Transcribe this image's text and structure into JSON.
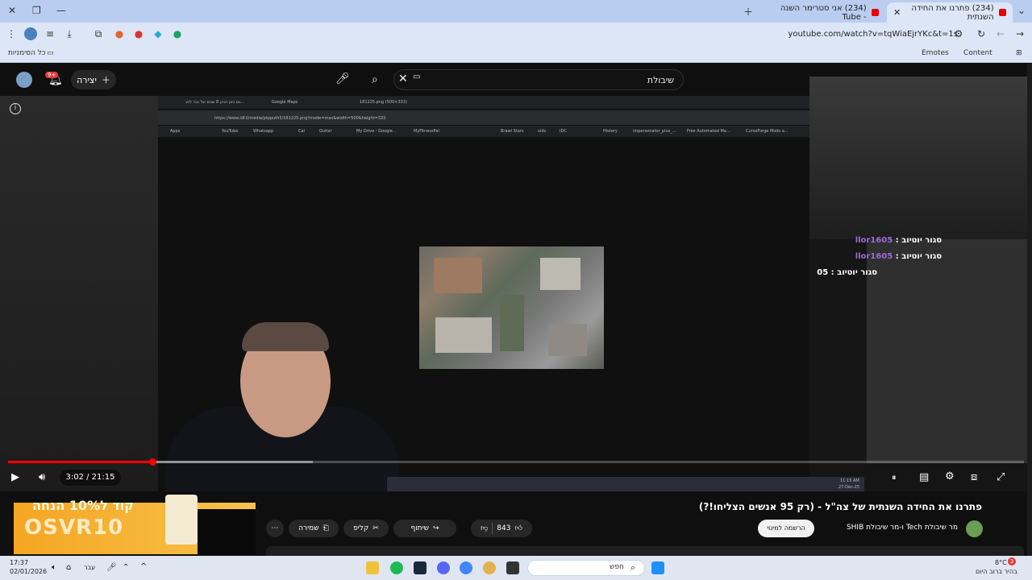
{
  "browser": {
    "tabs": [
      {
        "title": "(234) פתרנו את החידה השנתית",
        "active": true
      },
      {
        "title": "(234) אני סטרימר השנה - Tube",
        "active": false
      }
    ],
    "url": "youtube.com/watch?v=tqWiaEjrYKc&t=1s",
    "bookmarks_left": "כל הסימניות",
    "bookmarks_right": [
      "Emotes",
      "Content"
    ]
  },
  "youtube": {
    "search_query": "שיבולת",
    "create_label": "יצירה",
    "notif_badge": "9+",
    "video_title": "פתרנו את החידה השנתית של צה\"ל - (רק 95 אנשים הצליחו!?)",
    "channel_name": "מר שיבולת Tech ו-מר שיבולת SHIB",
    "subscribe_label": "הרשמה למינוי",
    "likes": "843",
    "share_label": "שיתוף",
    "clip_label": "קליפ",
    "save_label": "שמירה",
    "time_current": "3:02",
    "time_total": "21:15",
    "time_display": "3:02 / 21:15",
    "progress": {
      "played_fraction": 0.142,
      "buffered_fraction": 0.3
    }
  },
  "embedded_screen": {
    "tabs": [
      "גם כאן הגיע 8 שנים של נגה לפנ...",
      "Google Maps",
      "181225.png (500×333)"
    ],
    "url": "https://www.idf.il/media/ptpputh5/181225.png?mode=max&width=500&height=333",
    "bookmarks": [
      "Apps",
      "YouTube",
      "Whatsapp",
      "Cal",
      "Guitar",
      "My Drive - Google...",
      "MyFitnessPal",
      "Brawl Stars",
      "vids",
      "IDC",
      "History",
      "impersonator_plus_...",
      "Free Automated Ma...",
      "CurseForge Mods a..."
    ],
    "clock": "11:15 AM",
    "date": "27-Dec-25"
  },
  "chat": [
    {
      "badge_role": "סגור יוטיוב",
      "user": "llor1605",
      "text": ""
    },
    {
      "badge_role": "סגור יוטיוב",
      "user": "llor1605",
      "text": ""
    },
    {
      "badge_role": "סגור יוטיוב",
      "user": "",
      "text": "05"
    }
  ],
  "ad": {
    "text": "OSVR10",
    "top_text": "קוד ל10% הנחה"
  },
  "taskbar": {
    "search_label": "חפש",
    "time": "17:37",
    "date": "02/01/2026",
    "lang": "עבר",
    "weather_temp": "8°C",
    "weather_desc": "בהיר ברוב היום",
    "notif_count": "3"
  },
  "colors": {
    "youtube_red": "#ff0000",
    "chat_user": "#9b6bd6",
    "tab_bar": "#b9cdf0"
  }
}
